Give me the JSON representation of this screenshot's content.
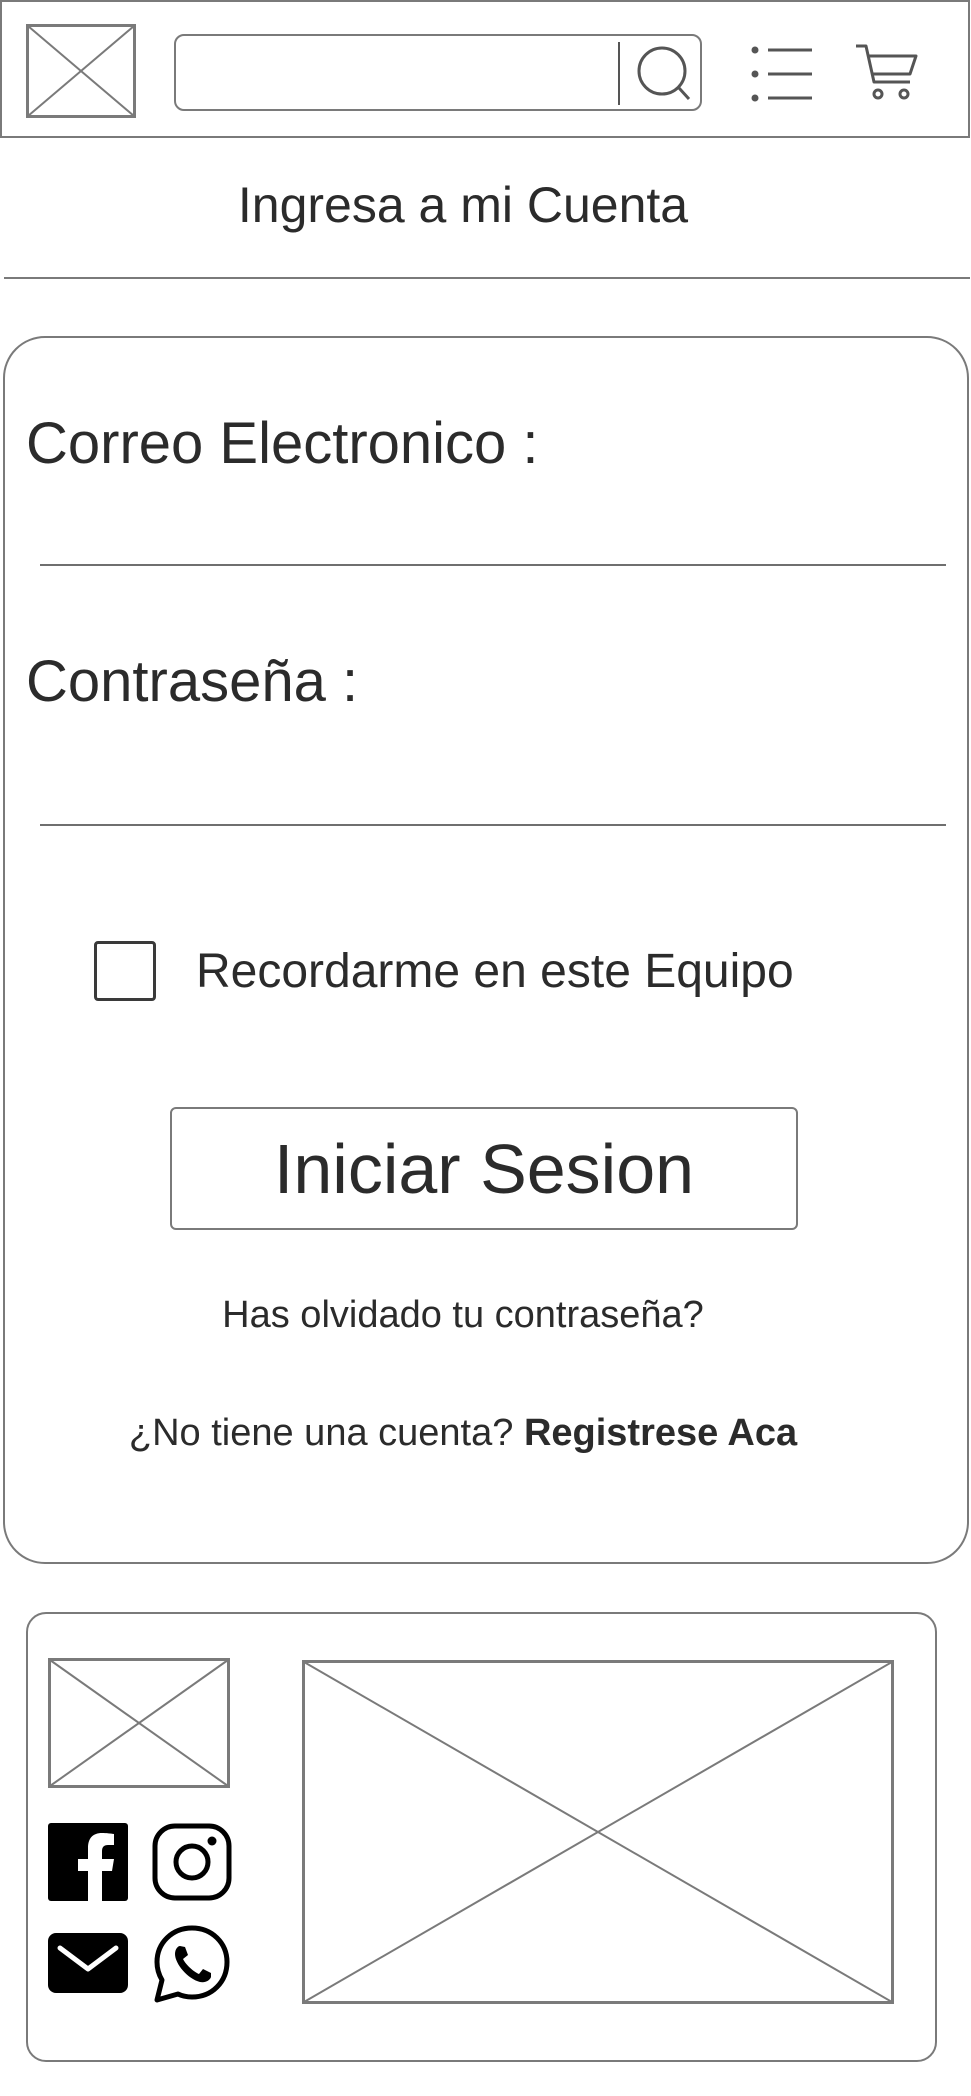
{
  "header": {
    "logo_icon": "logo-placeholder-icon",
    "search": {
      "placeholder": "",
      "value": "",
      "button_icon": "search-icon"
    },
    "menu_icon": "menu-list-icon",
    "cart_icon": "cart-icon"
  },
  "page": {
    "title": "Ingresa a mi Cuenta"
  },
  "login_form": {
    "email_label": "Correo Electronico :",
    "email_value": "",
    "password_label": "Contraseña :",
    "password_value": "",
    "remember_label": "Recordarme en este Equipo",
    "remember_checked": false,
    "submit_label": "Iniciar Sesion",
    "forgot_link": "Has olvidado tu contraseña?",
    "no_account_text": "¿No tiene una cuenta? ",
    "register_link": "Registrese Aca"
  },
  "footer": {
    "logo_icon": "logo-placeholder-icon",
    "image_icon": "image-placeholder-icon",
    "social": [
      {
        "icon": "facebook-icon"
      },
      {
        "icon": "instagram-icon"
      },
      {
        "icon": "mail-icon"
      },
      {
        "icon": "whatsapp-icon"
      }
    ]
  },
  "colors": {
    "outline": "#7a7a7a",
    "text": "#2b2b2b",
    "icon_fill": "#000000",
    "background": "#ffffff"
  }
}
